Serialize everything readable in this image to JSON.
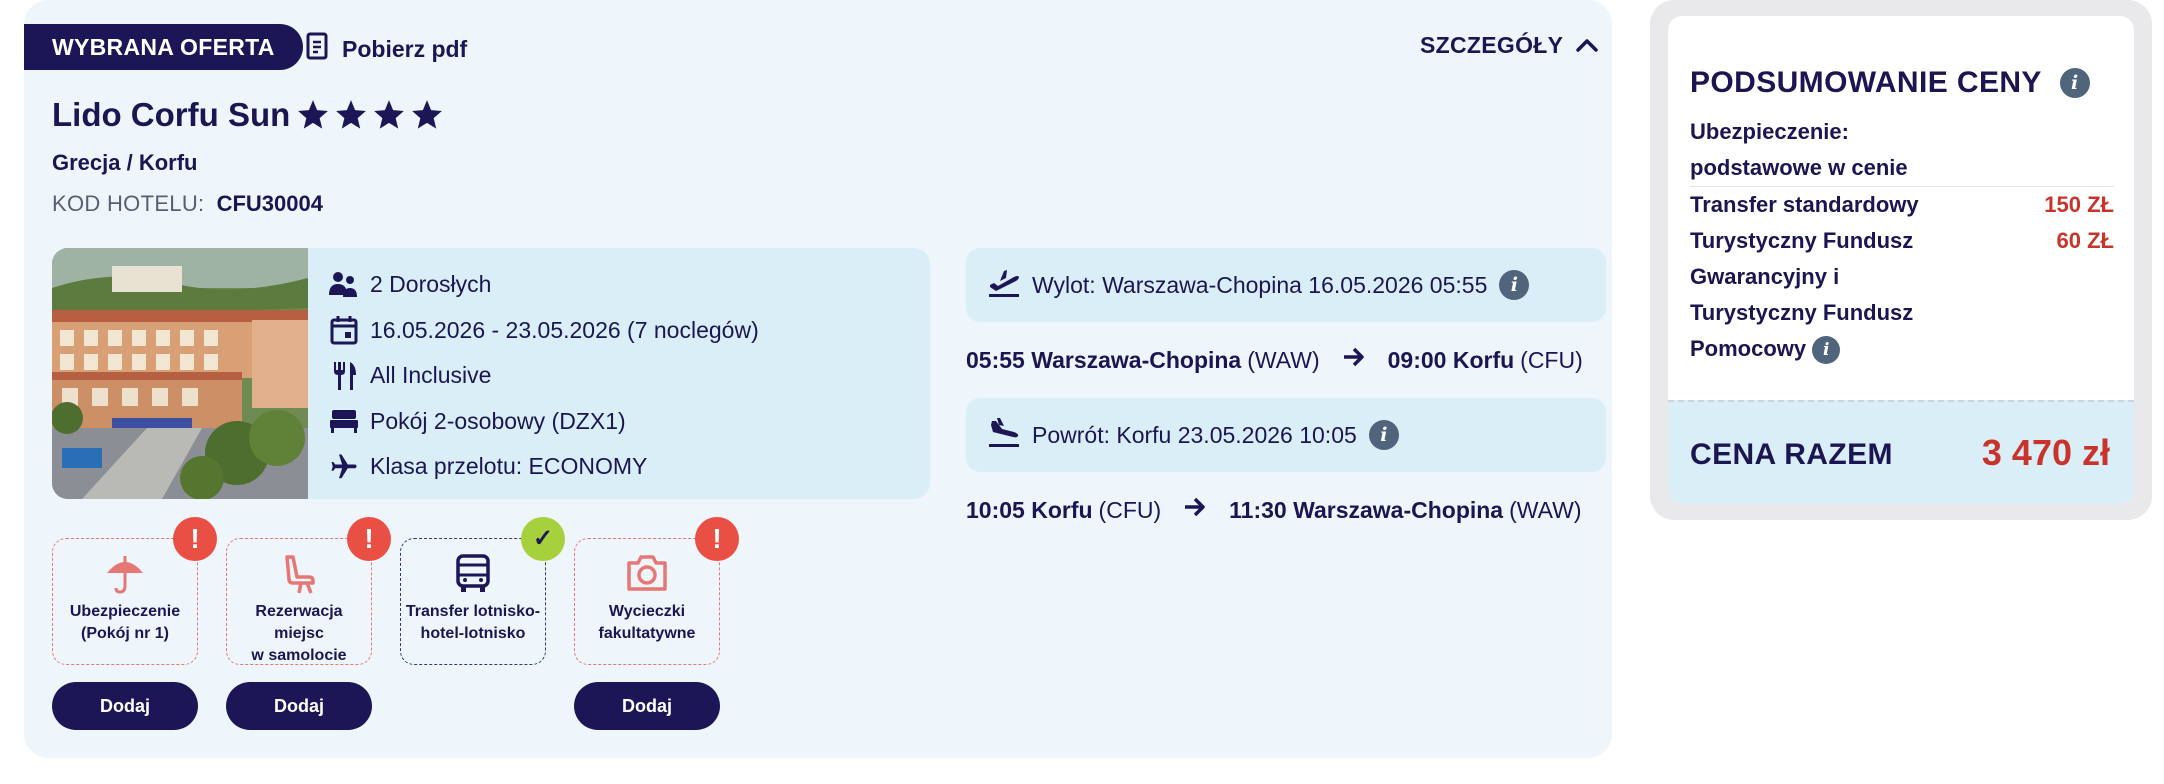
{
  "offer": {
    "badge": "WYBRANA OFERTA",
    "pdf_label": "Pobierz pdf",
    "details_label": "SZCZEGÓŁY",
    "hotel_name": "Lido Corfu Sun",
    "stars": 4,
    "location": "Grecja / Korfu",
    "hotel_code_label": "KOD HOTELU:",
    "hotel_code": "CFU30004",
    "info": {
      "guests": "2 Dorosłych",
      "dates": "16.05.2026 - 23.05.2026 (7 noclegów)",
      "board": "All Inclusive",
      "room": "Pokój 2-osobowy (DZX1)",
      "flight_class": "Klasa przelotu: ECONOMY"
    },
    "extras": [
      {
        "label_line1": "Ubezpieczenie",
        "label_line2": "(Pokój nr 1)",
        "status": "missing",
        "status_symbol": "!",
        "button": "Dodaj",
        "icon": "umbrella-icon"
      },
      {
        "label_line1": "Rezerwacja miejsc",
        "label_line2": "w samolocie",
        "status": "missing",
        "status_symbol": "!",
        "button": "Dodaj",
        "icon": "seat-icon"
      },
      {
        "label_line1": "Transfer lotnisko-",
        "label_line2": "hotel-lotnisko",
        "status": "included",
        "status_symbol": "✓",
        "button": "",
        "icon": "bus-icon"
      },
      {
        "label_line1": "Wycieczki",
        "label_line2": "fakultatywne",
        "status": "missing",
        "status_symbol": "!",
        "button": "Dodaj",
        "icon": "camera-icon"
      }
    ],
    "outbound": {
      "summary": "Wylot: Warszawa-Chopina 16.05.2026 05:55",
      "dep_time": "05:55",
      "dep_city": "Warszawa-Chopina",
      "dep_code": "(WAW)",
      "arr_time": "09:00",
      "arr_city": "Korfu",
      "arr_code": "(CFU)"
    },
    "inbound": {
      "summary": "Powrót: Korfu 23.05.2026 10:05",
      "dep_time": "10:05",
      "dep_city": "Korfu",
      "dep_code": "(CFU)",
      "arr_time": "11:30",
      "arr_city": "Warszawa-Chopina",
      "arr_code": "(WAW)"
    }
  },
  "summary": {
    "title": "PODSUMOWANIE CENY",
    "insurance_line1": "Ubezpieczenie:",
    "insurance_line2": "podstawowe w cenie",
    "rows": [
      {
        "label": "Transfer standardowy",
        "price": "150 ZŁ"
      },
      {
        "label": "Turystyczny Fundusz Gwarancyjny i Turystyczny Fundusz Pomocowy",
        "price": "60 ZŁ"
      }
    ],
    "total_label": "CENA RAZEM",
    "total_value": "3 470 zł"
  },
  "colors": {
    "navy": "#1c1656",
    "card_bg": "#eef6fc",
    "panel_bg": "#daeef8",
    "price_red": "#c8342b",
    "alert_red": "#ea4f44",
    "ok_green": "#a6d13d"
  }
}
